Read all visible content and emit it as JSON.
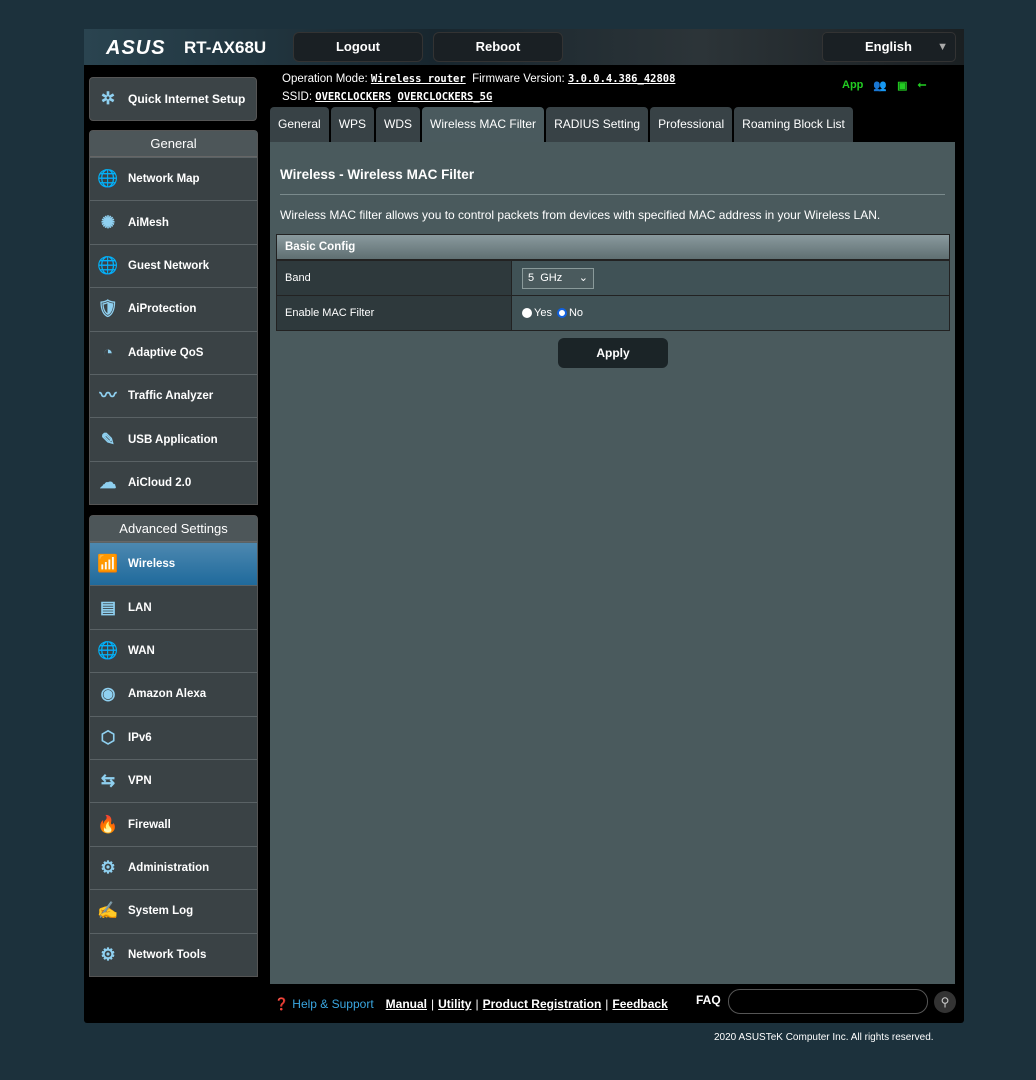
{
  "header": {
    "logo": "ASUS",
    "model": "RT-AX68U",
    "logout": "Logout",
    "reboot": "Reboot",
    "language": "English"
  },
  "info": {
    "op_mode_label": "Operation Mode:",
    "op_mode": "Wireless router",
    "fw_label": "Firmware Version:",
    "fw": "3.0.0.4.386_42808",
    "ssid_label": "SSID:",
    "ssid1": "OVERCLOCKERS",
    "ssid2": "OVERCLOCKERS_5G",
    "app": "App"
  },
  "sidebar": {
    "quick": "Quick Internet Setup",
    "general_title": "General",
    "general": [
      {
        "label": "Network Map",
        "icon": "globe"
      },
      {
        "label": "AiMesh",
        "icon": "mesh"
      },
      {
        "label": "Guest Network",
        "icon": "globe-users"
      },
      {
        "label": "AiProtection",
        "icon": "shield"
      },
      {
        "label": "Adaptive QoS",
        "icon": "gauge"
      },
      {
        "label": "Traffic Analyzer",
        "icon": "chart"
      },
      {
        "label": "USB Application",
        "icon": "usb"
      },
      {
        "label": "AiCloud 2.0",
        "icon": "cloud"
      }
    ],
    "advanced_title": "Advanced Settings",
    "advanced": [
      {
        "label": "Wireless",
        "icon": "wifi"
      },
      {
        "label": "LAN",
        "icon": "lan"
      },
      {
        "label": "WAN",
        "icon": "globe"
      },
      {
        "label": "Amazon Alexa",
        "icon": "alexa"
      },
      {
        "label": "IPv6",
        "icon": "ipv6"
      },
      {
        "label": "VPN",
        "icon": "vpn"
      },
      {
        "label": "Firewall",
        "icon": "fire"
      },
      {
        "label": "Administration",
        "icon": "gear"
      },
      {
        "label": "System Log",
        "icon": "log"
      },
      {
        "label": "Network Tools",
        "icon": "tools"
      }
    ]
  },
  "tabs": [
    "General",
    "WPS",
    "WDS",
    "Wireless MAC Filter",
    "RADIUS Setting",
    "Professional",
    "Roaming Block List"
  ],
  "main": {
    "title": "Wireless - Wireless MAC Filter",
    "desc": "Wireless MAC filter allows you to control packets from devices with specified MAC address in your Wireless LAN.",
    "table_title": "Basic Config",
    "band_label": "Band",
    "band_value": "5  GHz",
    "mac_label": "Enable MAC Filter",
    "yes": "Yes",
    "no": "No",
    "selected": "No",
    "apply": "Apply"
  },
  "footer": {
    "help": "Help & Support",
    "manual": "Manual",
    "utility": "Utility",
    "registration": "Product Registration",
    "feedback": "Feedback",
    "faq": "FAQ",
    "copyright": "2020 ASUSTeK Computer Inc. All rights reserved."
  }
}
